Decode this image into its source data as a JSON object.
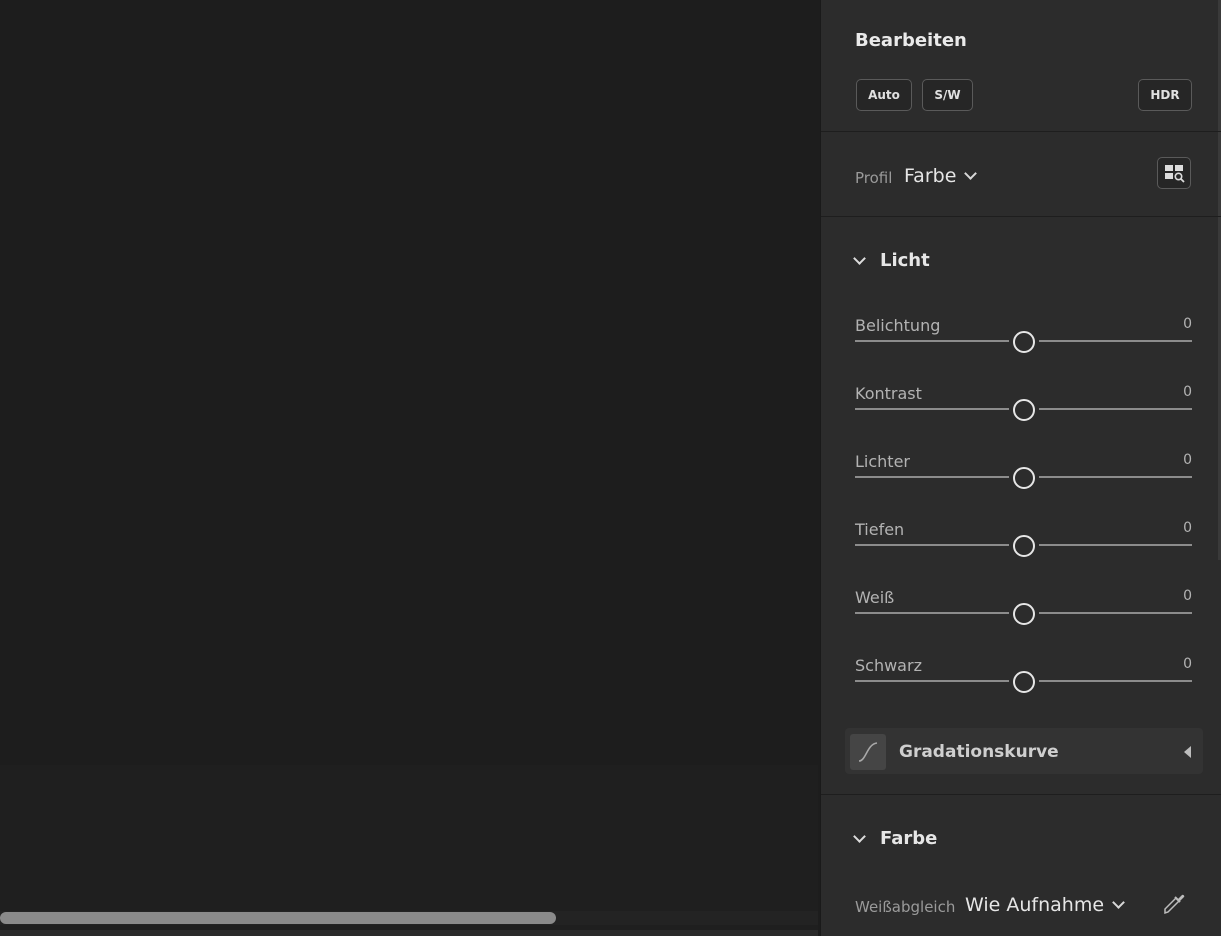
{
  "panel": {
    "title": "Bearbeiten",
    "buttons": {
      "auto": "Auto",
      "bw": "S/W",
      "hdr": "HDR"
    },
    "profile": {
      "label": "Profil",
      "value": "Farbe"
    }
  },
  "light": {
    "title": "Licht",
    "sliders": [
      {
        "label": "Belichtung",
        "value": "0",
        "level": 0.5
      },
      {
        "label": "Kontrast",
        "value": "0",
        "level": 0.5
      },
      {
        "label": "Lichter",
        "value": "0",
        "level": 0.5
      },
      {
        "label": "Tiefen",
        "value": "0",
        "level": 0.5
      },
      {
        "label": "Weiß",
        "value": "0",
        "level": 0.5
      },
      {
        "label": "Schwarz",
        "value": "0",
        "level": 0.5
      }
    ],
    "curve_label": "Gradationskurve"
  },
  "color": {
    "title": "Farbe",
    "wb_label": "Weißabgleich",
    "wb_value": "Wie Aufnahme"
  },
  "canvas": {
    "scroll_position": 0.68
  }
}
